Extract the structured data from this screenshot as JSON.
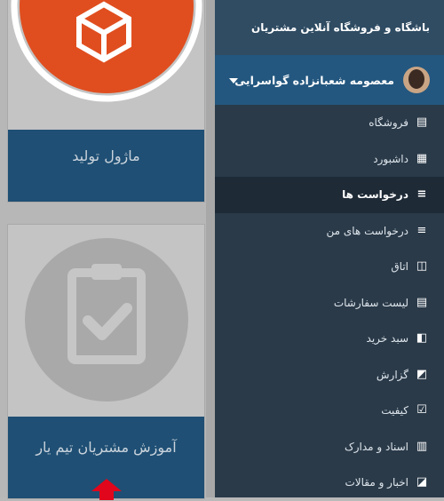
{
  "sidebar": {
    "brand": "باشگاه و فروشگاه آنلاین مشتریان",
    "user_name": "معصومه شعبانزاده گواسرایی",
    "items": [
      {
        "label": "فروشگاه",
        "icon": "clipboard-list-icon",
        "active": false
      },
      {
        "label": "داشبورد",
        "icon": "grid-icon",
        "active": false
      },
      {
        "label": "درخواست ها",
        "icon": "list-icon",
        "active": true
      },
      {
        "label": "درخواست های من",
        "icon": "list-icon",
        "active": false
      },
      {
        "label": "اتاق",
        "icon": "chat-icon",
        "active": false
      },
      {
        "label": "لیست سفارشات",
        "icon": "clipboard-list-icon",
        "active": false
      },
      {
        "label": "سبد خرید",
        "icon": "cart-icon",
        "active": false
      },
      {
        "label": "گزارش",
        "icon": "chart-icon",
        "active": false
      },
      {
        "label": "کیفیت",
        "icon": "check-icon",
        "active": false
      },
      {
        "label": "اسناد و مدارک",
        "icon": "document-icon",
        "active": false
      },
      {
        "label": "اخبار و مقالات",
        "icon": "megaphone-icon",
        "active": false
      }
    ]
  },
  "cards": [
    {
      "caption": "ماژول تولید",
      "icon": "box-icon"
    },
    {
      "caption": "آموزش مشتریان تیم یار",
      "icon": "clipboard-check-icon"
    }
  ],
  "colors": {
    "accent": "#e04e1f",
    "nav_bg": "#2a3a49",
    "brand_bg": "#2f4c63",
    "user_bg": "#23577f",
    "caption_bg": "#1f4f74",
    "arrow": "#e1061b"
  }
}
